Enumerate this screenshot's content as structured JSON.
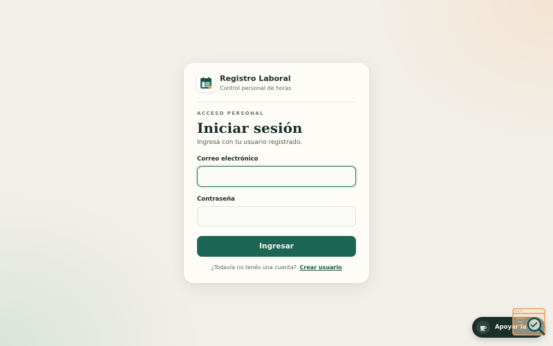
{
  "brand": {
    "name": "Registro Laboral",
    "tagline": "Control personal de horas",
    "logo_icon": "calendar-checklist-icon"
  },
  "login": {
    "eyebrow": "ACCESO PERSONAL",
    "title": "Iniciar sesión",
    "subtitle": "Ingresá con tu usuario registrado.",
    "email_label": "Correo electrónico",
    "email_value": "",
    "password_label": "Contraseña",
    "password_value": "",
    "submit_label": "Ingresar",
    "signup_prompt": "¿Todavía no tenés una cuenta?",
    "signup_link": "Crear usuario"
  },
  "support": {
    "label": "Apoyar la",
    "icon": "coffee-cup-icon"
  },
  "colors": {
    "accent": "#1d6655",
    "card": "#fdfcf7",
    "support_bg": "#1a2e2a",
    "corner_orange": "#e8a15a"
  }
}
